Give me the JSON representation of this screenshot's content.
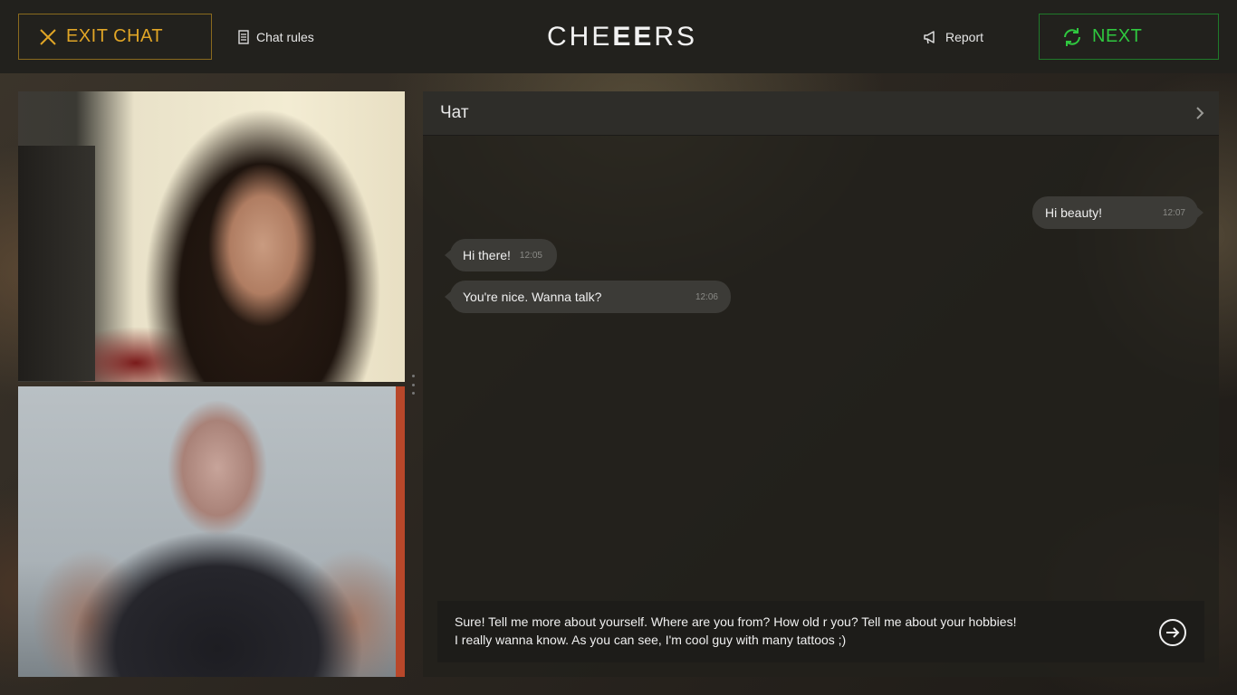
{
  "topbar": {
    "exit_label": "EXIT CHAT",
    "rules_label": "Chat rules",
    "logo": {
      "part1": "CH",
      "part2": "E",
      "part3": "EE",
      "part4": "RS"
    },
    "report_label": "Report",
    "next_label": "NEXT"
  },
  "chat": {
    "title": "Чат",
    "messages": [
      {
        "text": "Hi beauty!",
        "time": "12:07",
        "direction": "out"
      },
      {
        "text": "Hi there!",
        "time": "12:05",
        "direction": "in"
      },
      {
        "text": "You're nice. Wanna talk?",
        "time": "12:06",
        "direction": "in"
      }
    ],
    "composer": {
      "line1": "Sure! Tell me more about yourself. Where are you from? How old r you? Tell me about your hobbies!",
      "line2": "I really wanna know. As you can see, I'm cool guy with many tattoos ;)"
    }
  },
  "colors": {
    "exit_accent": "#e0a526",
    "next_accent": "#2fc83f"
  },
  "icons": {
    "exit": "close-icon",
    "rules": "document-icon",
    "report": "megaphone-icon",
    "next": "refresh-icon",
    "header": "chevron-right-icon",
    "send": "arrow-right-circle-icon"
  }
}
